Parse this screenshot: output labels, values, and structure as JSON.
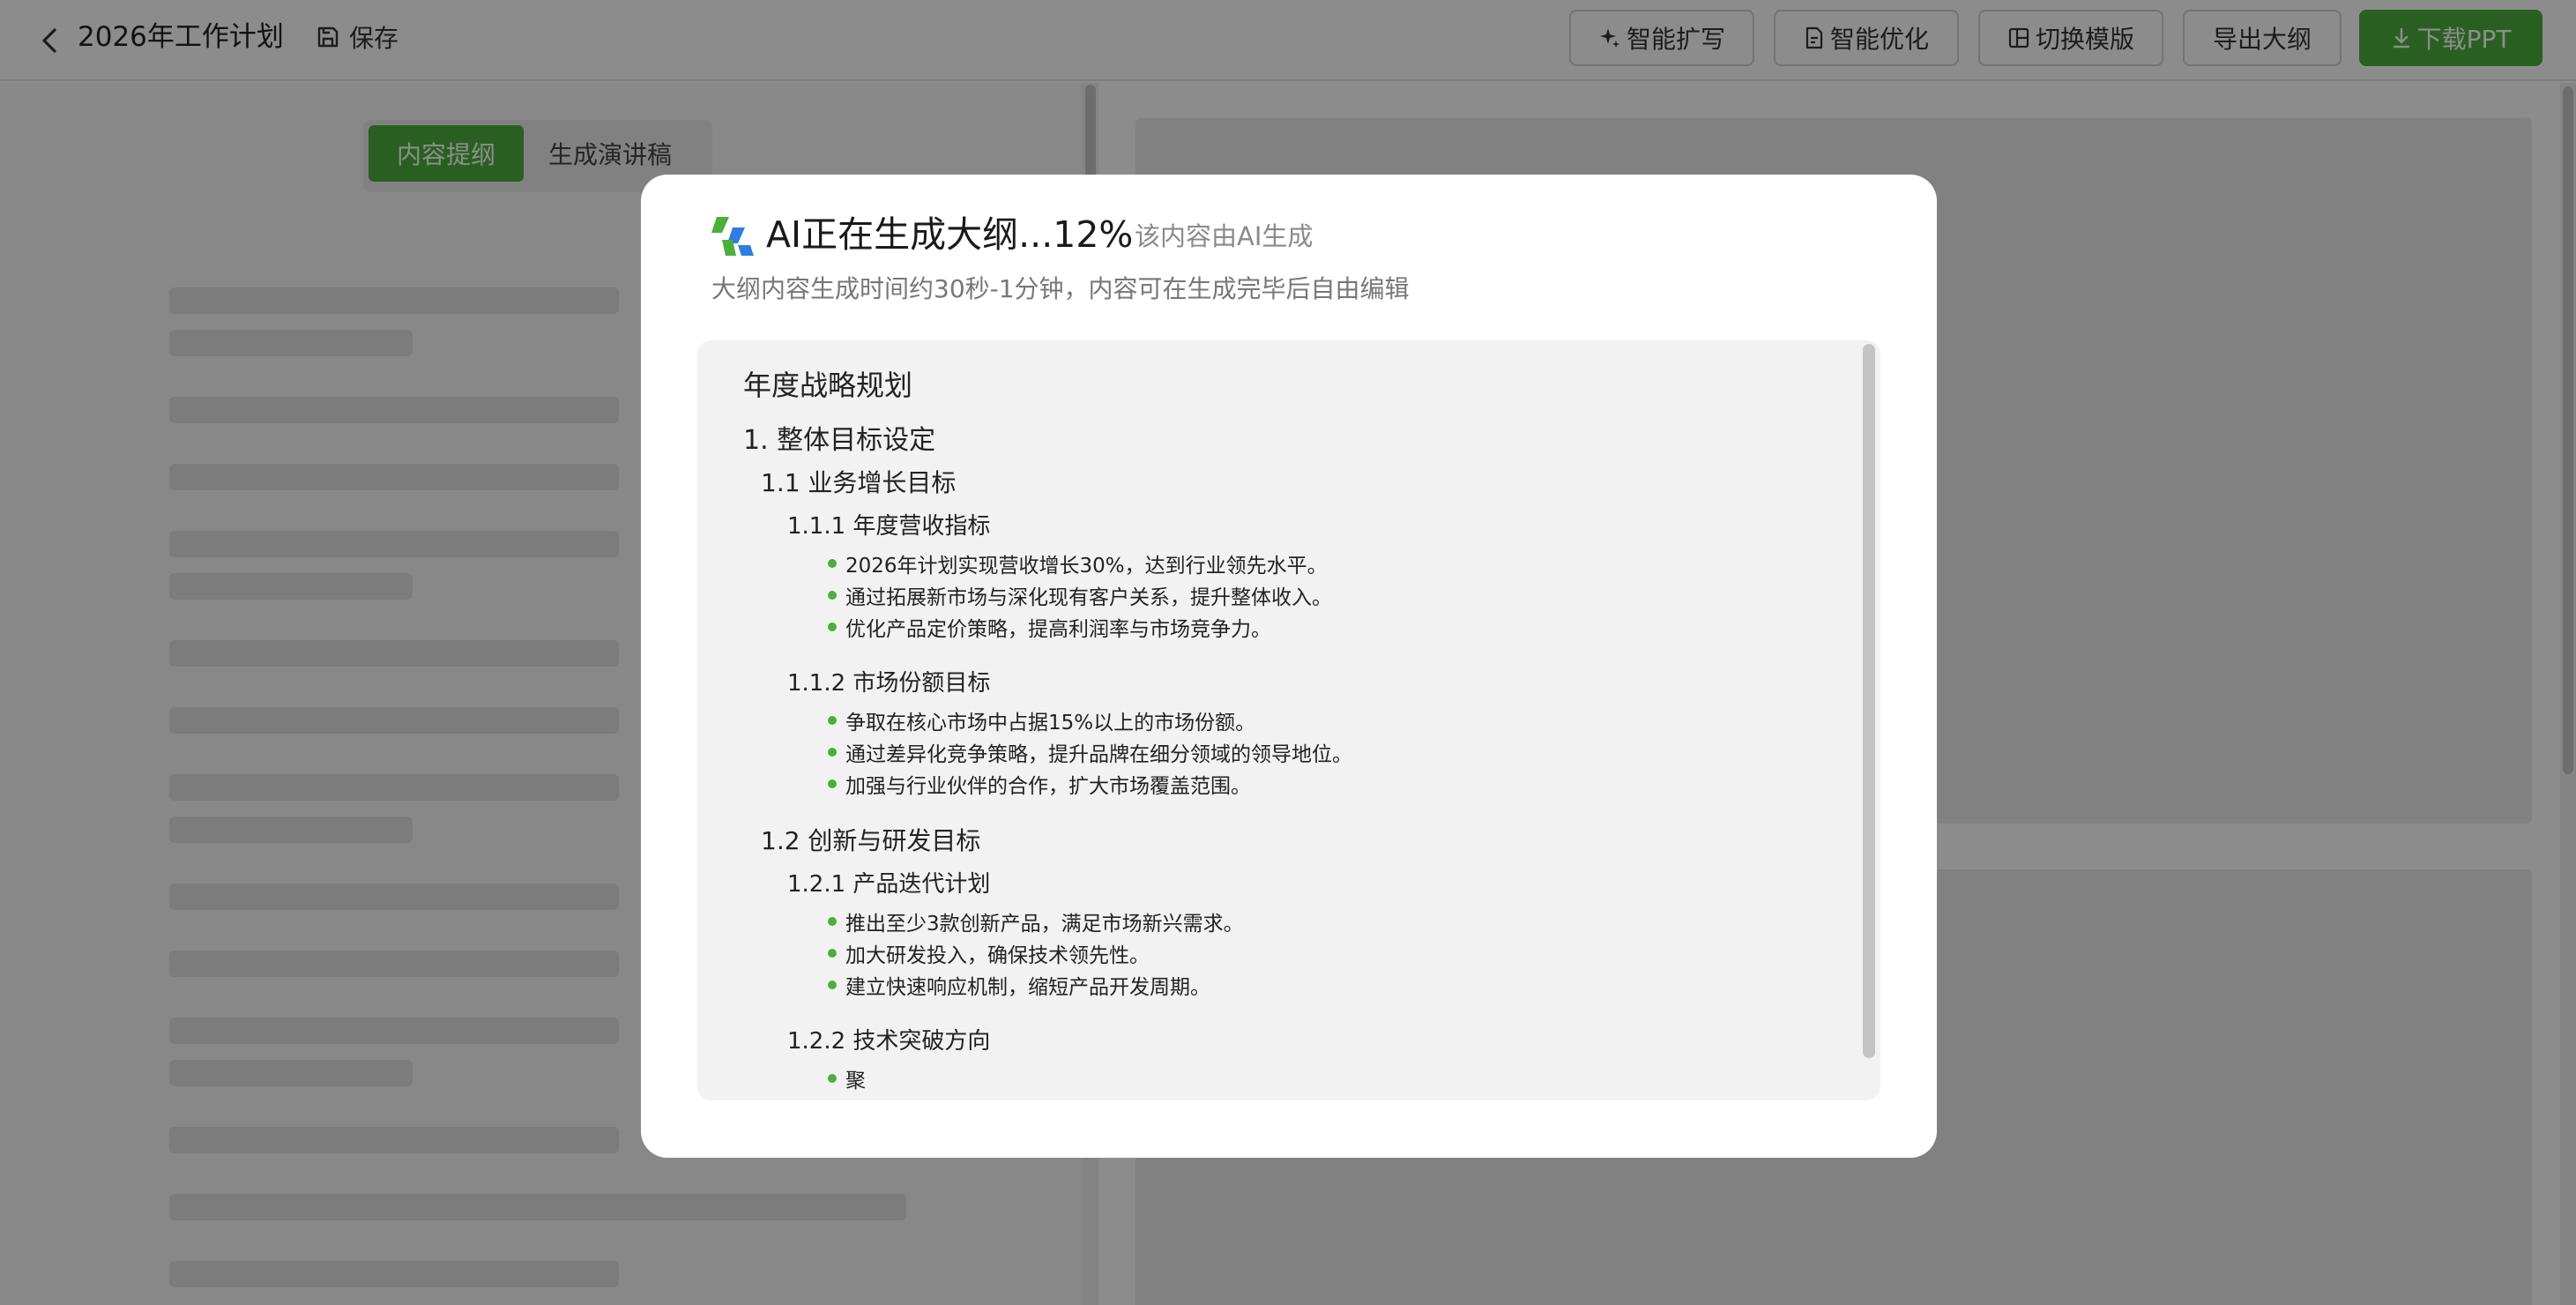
{
  "header": {
    "title": "2026年工作计划",
    "save_label": "保存",
    "buttons": {
      "ai_expand": "智能扩写",
      "ai_optimize": "智能优化",
      "switch_template": "切换模版",
      "export_outline": "导出大纲",
      "download_ppt": "下载PPT"
    }
  },
  "left_panel": {
    "tabs": [
      "内容提纲",
      "生成演讲稿"
    ],
    "active_tab": "内容提纲"
  },
  "modal": {
    "title": "AI正在生成大纲...12%",
    "ai_note": "该内容由AI生成",
    "subtitle": "大纲内容生成时间约30秒-1分钟，内容可在生成完毕后自由编辑",
    "progress_percent": 12,
    "outline": {
      "title": "年度战略规划",
      "s1": "1. 整体目标设定",
      "s1_1": "1.1 业务增长目标",
      "s1_1_1": "1.1.1 年度营收指标",
      "s1_1_1_items": [
        "2026年计划实现营收增长30%，达到行业领先水平。",
        "通过拓展新市场与深化现有客户关系，提升整体收入。",
        "优化产品定价策略，提高利润率与市场竞争力。"
      ],
      "s1_1_2": "1.1.2 市场份额目标",
      "s1_1_2_items": [
        "争取在核心市场中占据15%以上的市场份额。",
        "通过差异化竞争策略，提升品牌在细分领域的领导地位。",
        "加强与行业伙伴的合作，扩大市场覆盖范围。"
      ],
      "s1_2": "1.2 创新与研发目标",
      "s1_2_1": "1.2.1 产品迭代计划",
      "s1_2_1_items": [
        "推出至少3款创新产品，满足市场新兴需求。",
        "加大研发投入，确保技术领先性。",
        "建立快速响应机制，缩短产品开发周期。"
      ],
      "s1_2_2": "1.2.2 技术突破方向",
      "s1_2_2_items": [
        "聚"
      ]
    }
  },
  "colors": {
    "accent": "#4caf3c",
    "overlay": "rgba(0,0,0,0.45)"
  }
}
